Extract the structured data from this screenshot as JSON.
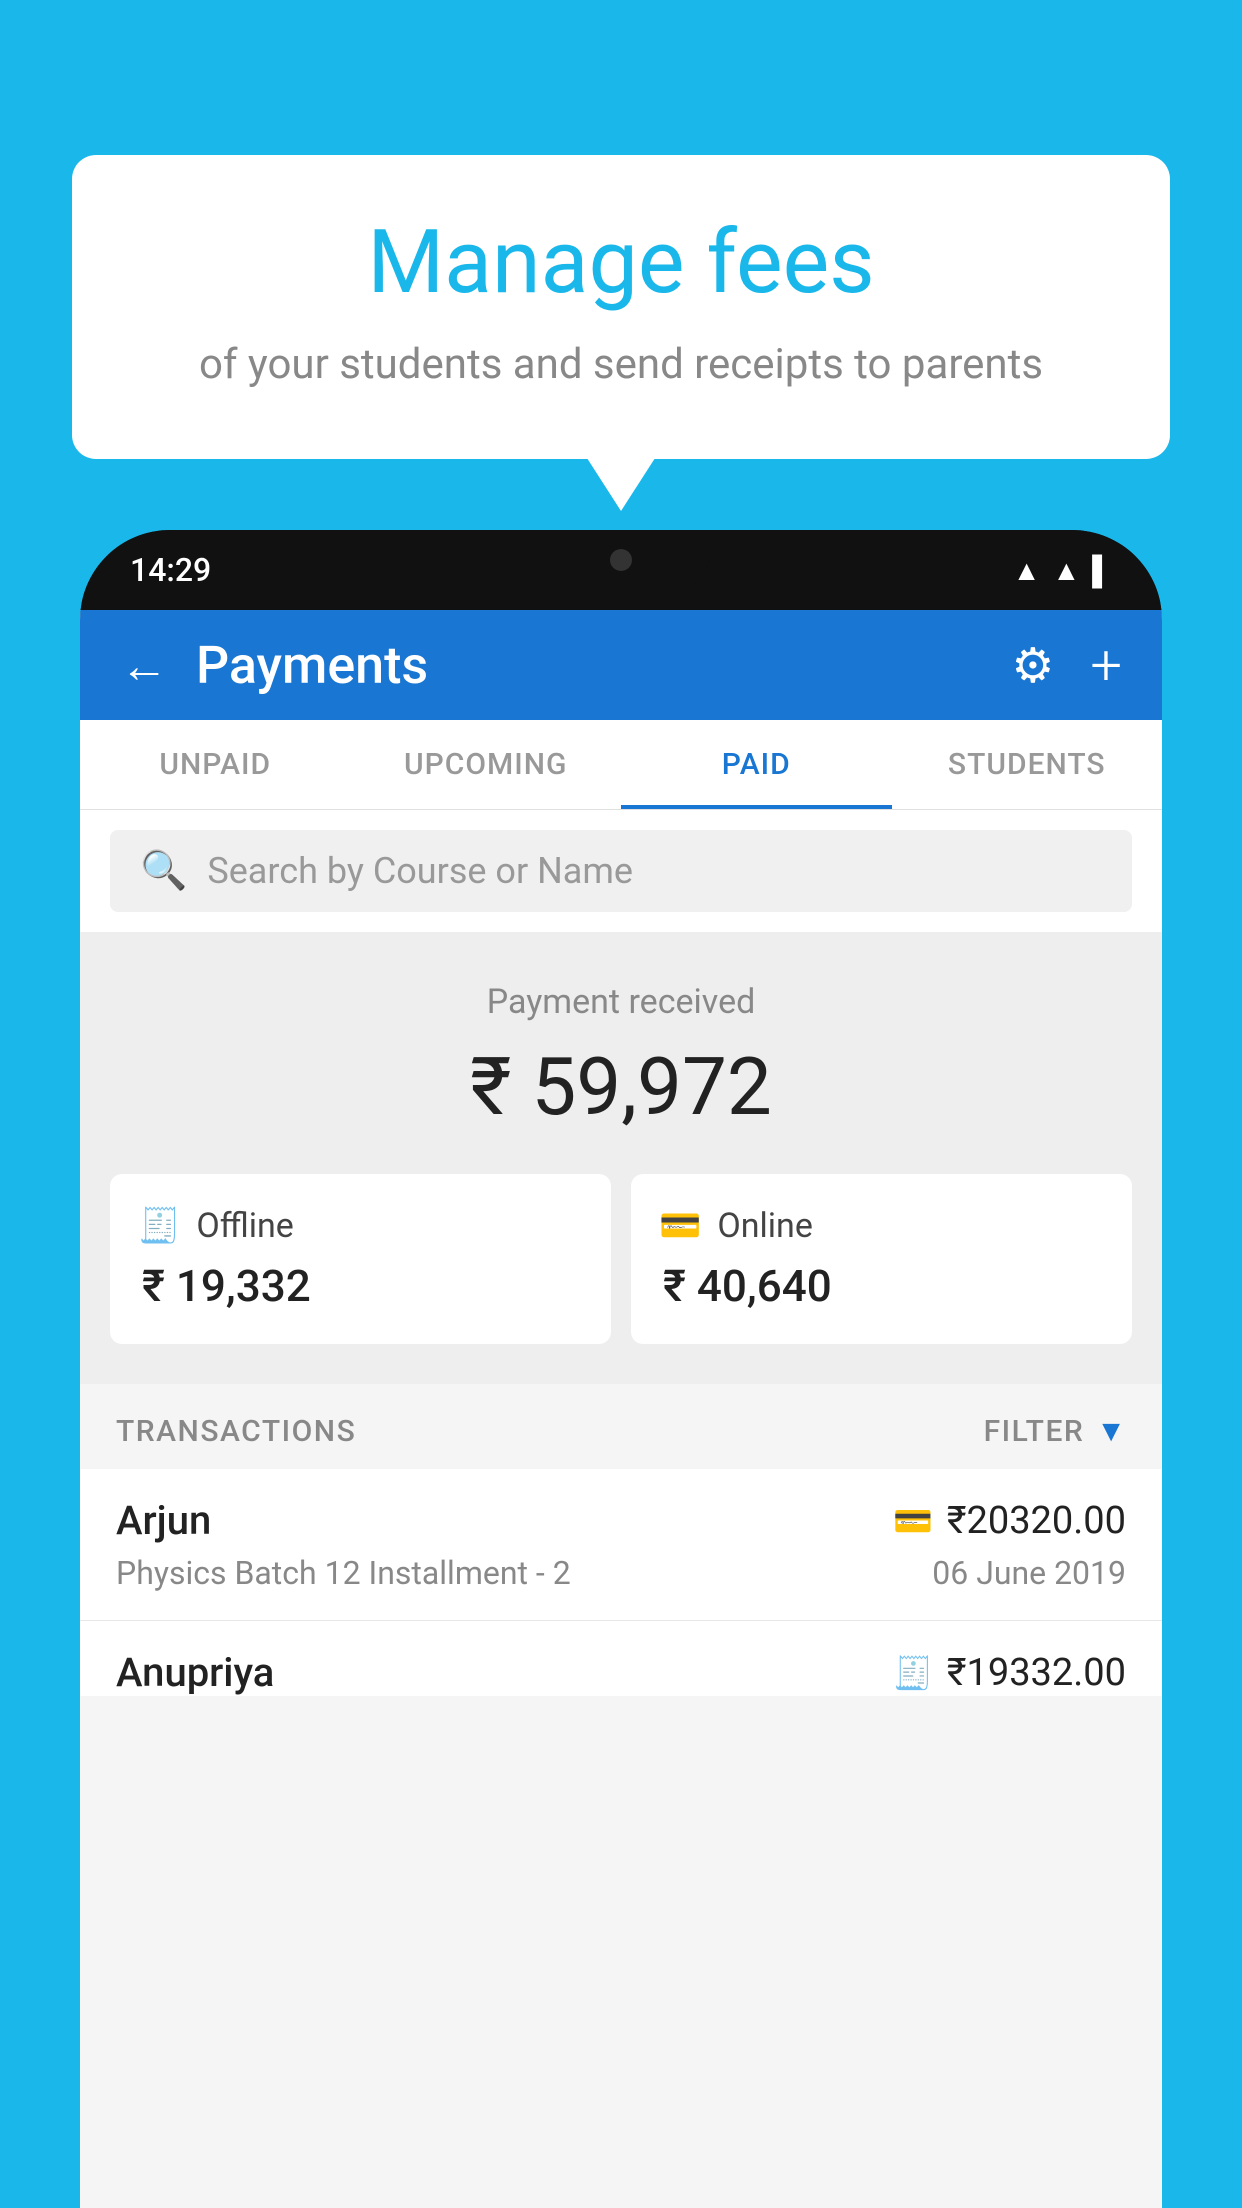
{
  "background_color": "#1ab7ea",
  "speech_bubble": {
    "title": "Manage fees",
    "subtitle": "of your students and send receipts to parents"
  },
  "phone": {
    "time": "14:29",
    "header": {
      "title": "Payments",
      "back_label": "←",
      "gear_label": "⚙",
      "plus_label": "+"
    },
    "tabs": [
      {
        "id": "unpaid",
        "label": "UNPAID",
        "active": false
      },
      {
        "id": "upcoming",
        "label": "UPCOMING",
        "active": false
      },
      {
        "id": "paid",
        "label": "PAID",
        "active": true
      },
      {
        "id": "students",
        "label": "STUDENTS",
        "active": false
      }
    ],
    "search": {
      "placeholder": "Search by Course or Name"
    },
    "payment_summary": {
      "received_label": "Payment received",
      "total_amount": "₹ 59,972",
      "offline_label": "Offline",
      "offline_amount": "₹ 19,332",
      "online_label": "Online",
      "online_amount": "₹ 40,640"
    },
    "transactions": {
      "section_label": "TRANSACTIONS",
      "filter_label": "FILTER",
      "rows": [
        {
          "name": "Arjun",
          "detail": "Physics Batch 12 Installment - 2",
          "amount": "₹20320.00",
          "date": "06 June 2019",
          "payment_type": "online"
        },
        {
          "name": "Anupriya",
          "detail": "",
          "amount": "₹19332.00",
          "date": "",
          "payment_type": "offline"
        }
      ]
    }
  },
  "icons": {
    "search": "🔍",
    "gear": "⚙",
    "back_arrow": "←",
    "plus": "+",
    "filter_funnel": "▼",
    "online_card": "💳",
    "offline_card": "🧾",
    "wifi": "▲",
    "signal": "▲",
    "battery": "▌"
  }
}
